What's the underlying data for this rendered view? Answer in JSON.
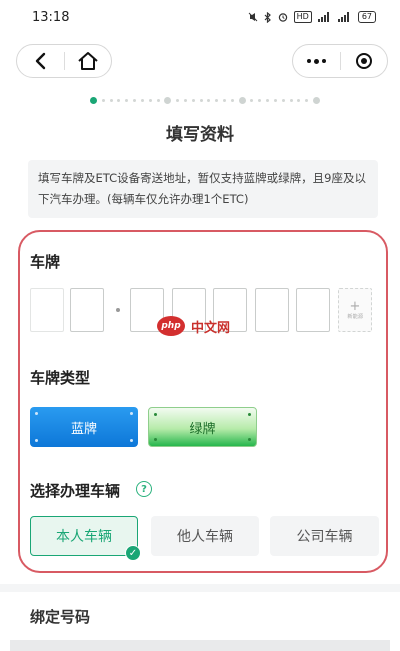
{
  "status_bar": {
    "time": "13:18",
    "icons": [
      "silent-icon",
      "bluetooth-icon",
      "alarm-icon",
      "hd-icon",
      "signal-icon",
      "signal-icon",
      "battery-icon"
    ],
    "hd_label": "HD",
    "battery": "67"
  },
  "nav": {
    "back_icon": "chevron-left-icon",
    "home_icon": "home-icon",
    "menu_icon": "more-dots-icon",
    "close_icon": "target-close-icon"
  },
  "progress": {
    "steps": 4,
    "current": 1
  },
  "page": {
    "title": "填写资料"
  },
  "notice": {
    "text": "填写车牌及ETC设备寄送地址，暂仅支持蓝牌或绿牌，且9座及以下汽车办理。(每辆车仅允许办理1个ETC)"
  },
  "plate": {
    "label": "车牌",
    "cells": [
      "",
      "",
      "",
      "",
      "",
      "",
      ""
    ],
    "new_energy_plus": "+",
    "new_energy_label": "新能源"
  },
  "watermark": {
    "logo": "php",
    "text": "中文网"
  },
  "plate_type": {
    "label": "车牌类型",
    "options": [
      "蓝牌",
      "绿牌"
    ],
    "colors": {
      "blue": "#1183e3",
      "green": "#3cc15c"
    }
  },
  "vehicle": {
    "label": "选择办理车辆",
    "help": "?",
    "options": [
      "本人车辆",
      "他人车辆",
      "公司车辆"
    ],
    "selected": "本人车辆",
    "check": "✓",
    "accent": "#1aa675"
  },
  "binding": {
    "label": "绑定号码"
  }
}
